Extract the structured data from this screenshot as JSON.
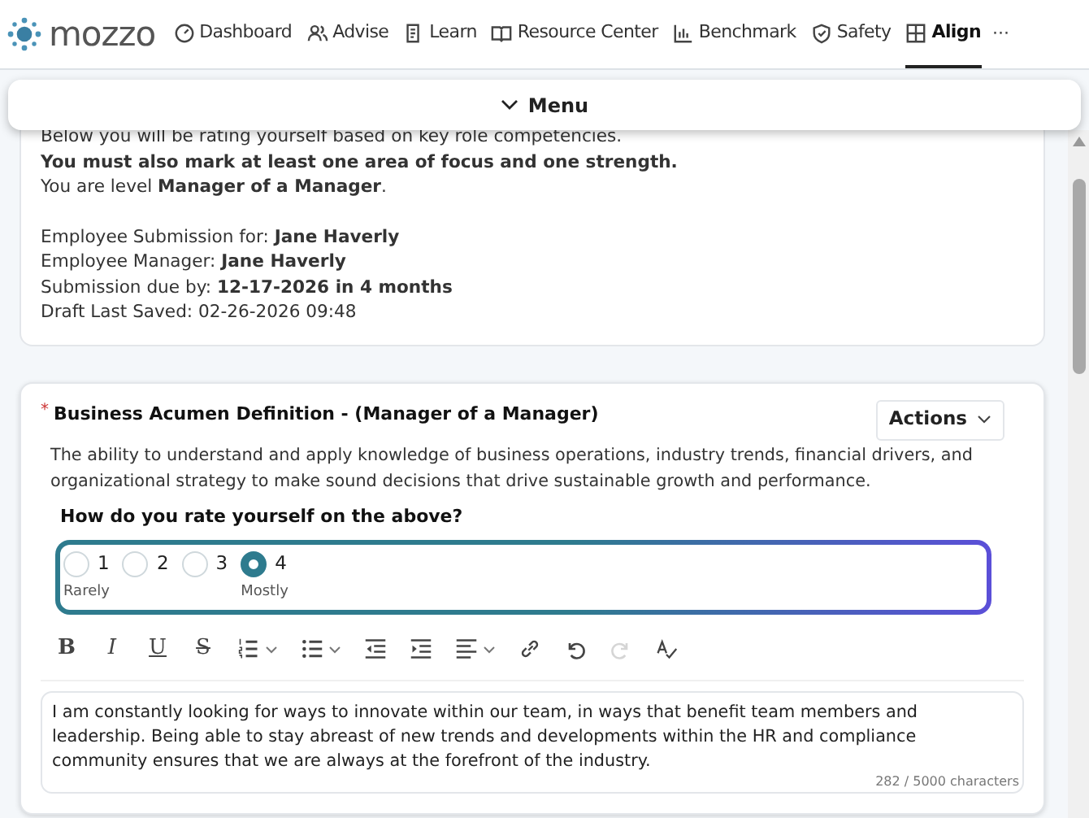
{
  "brand": {
    "name": "mozzo"
  },
  "nav": [
    {
      "label": "Dashboard",
      "kind": "gauge",
      "selected": false
    },
    {
      "label": "Advise",
      "kind": "people",
      "selected": false
    },
    {
      "label": "Learn",
      "kind": "doc",
      "selected": false
    },
    {
      "label": "Resource Center",
      "kind": "book",
      "selected": false
    },
    {
      "label": "Benchmark",
      "kind": "chart",
      "selected": false
    },
    {
      "label": "Safety",
      "kind": "shield",
      "selected": false
    },
    {
      "label": "Align",
      "kind": "grid",
      "selected": true
    }
  ],
  "more": "···",
  "menu_bar": {
    "label": "Menu"
  },
  "intro": {
    "lines": [
      "Below you will be rating yourself based on key role competencies.",
      "**You must also mark at least one area of focus and one strength.**",
      "You are level **Manager of a Manager**."
    ],
    "details": [
      "Employee Submission for: **Jane Haverly**",
      "Employee Manager: **Jane Haverly**",
      "Submission due by: **12-17-2026 in 4 months**",
      "Draft Last Saved: 02-26-2026 09:48"
    ]
  },
  "competency": {
    "required_mark": "*",
    "title": "Business Acumen Definition - (Manager of a Manager)",
    "actions": "Actions",
    "description": "The ability to understand and apply knowledge of business operations, industry trends, financial drivers, and organizational strategy to make sound decisions that drive sustainable growth and performance.",
    "question": "How do you rate yourself on the above?",
    "rating": [
      {
        "label": "1",
        "selected": false,
        "caption": "Rarely"
      },
      {
        "label": "2",
        "selected": false
      },
      {
        "label": "3",
        "selected": false
      },
      {
        "label": "4",
        "selected": true,
        "caption": "Mostly"
      }
    ],
    "toolbar": [
      {
        "kind": "bold",
        "label": "B",
        "disabled": false
      },
      {
        "kind": "italic",
        "label": "I",
        "disabled": false
      },
      {
        "kind": "underline",
        "label": "U",
        "disabled": false
      },
      {
        "kind": "strike",
        "label": "S",
        "disabled": false
      },
      {
        "kind": "ordered-list",
        "dropdown": true,
        "disabled": false
      },
      {
        "kind": "bullet-list",
        "dropdown": true,
        "disabled": false
      },
      {
        "kind": "outdent",
        "dropdown": false,
        "disabled": false
      },
      {
        "kind": "indent",
        "dropdown": false,
        "disabled": false
      },
      {
        "kind": "align",
        "dropdown": true,
        "disabled": false
      },
      {
        "kind": "link",
        "dropdown": false,
        "disabled": false
      },
      {
        "kind": "undo",
        "dropdown": false,
        "disabled": false
      },
      {
        "kind": "redo",
        "dropdown": false,
        "disabled": true
      },
      {
        "kind": "spellcheck",
        "dropdown": false,
        "disabled": false
      }
    ],
    "answer": "I am constantly looking for ways to innovate within our team, in ways that benefit team members and leadership. Being able to stay abreast of new trends and developments within the HR and compliance community ensures that we are always at the forefront of the industry.",
    "counter": "282 / 5000 characters"
  }
}
